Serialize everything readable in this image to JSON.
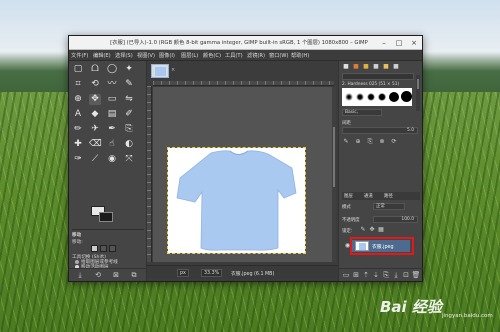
{
  "window": {
    "title": "[衣服] (已导入)-1.0 (RGB 颜色 8-bit gamma integer, GIMP built-in sRGB, 1 个图层) 1080x800 – GIMP",
    "controls": {
      "minimize": "–",
      "maximize": "□",
      "close": "×"
    }
  },
  "menubar": [
    "文件(F)",
    "编辑(E)",
    "选择(S)",
    "视图(V)",
    "图像(I)",
    "图层(L)",
    "颜色(C)",
    "工具(T)",
    "滤镜(R)",
    "窗口(W)",
    "帮助(H)"
  ],
  "toolbox": {
    "tools": [
      {
        "name": "rect-select-tool-icon",
        "glyph": "▢"
      },
      {
        "name": "lasso-tool-icon",
        "glyph": "ᗝ"
      },
      {
        "name": "ellipse-select-tool-icon",
        "glyph": "◯"
      },
      {
        "name": "fuzzy-select-tool-icon",
        "glyph": "✦"
      },
      {
        "name": "crop-tool-icon",
        "glyph": "⌗"
      },
      {
        "name": "transform-tool-icon",
        "glyph": "⟲"
      },
      {
        "name": "warp-tool-icon",
        "glyph": "〰"
      },
      {
        "name": "paths-tool-icon",
        "glyph": "✎"
      },
      {
        "name": "zoom-tool-icon",
        "glyph": "⊕"
      },
      {
        "name": "move-tool-icon",
        "glyph": "✥"
      },
      {
        "name": "align-tool-icon",
        "glyph": "▭"
      },
      {
        "name": "flip-tool-icon",
        "glyph": "⇋"
      },
      {
        "name": "text-tool-icon",
        "glyph": "A"
      },
      {
        "name": "bucket-fill-tool-icon",
        "glyph": "◆"
      },
      {
        "name": "gradient-tool-icon",
        "glyph": "▤"
      },
      {
        "name": "paintbrush-tool-icon",
        "glyph": "✐"
      },
      {
        "name": "pencil-tool-icon",
        "glyph": "✏"
      },
      {
        "name": "airbrush-tool-icon",
        "glyph": "✈"
      },
      {
        "name": "ink-tool-icon",
        "glyph": "✒"
      },
      {
        "name": "clone-tool-icon",
        "glyph": "⎘"
      },
      {
        "name": "heal-tool-icon",
        "glyph": "✚"
      },
      {
        "name": "eraser-tool-icon",
        "glyph": "⌫"
      },
      {
        "name": "smudge-tool-icon",
        "glyph": "☝"
      },
      {
        "name": "dodge-tool-icon",
        "glyph": "◐"
      },
      {
        "name": "color-picker-tool-icon",
        "glyph": "✑"
      },
      {
        "name": "measure-tool-icon",
        "glyph": "⟋"
      },
      {
        "name": "blur-tool-icon",
        "glyph": "◉"
      },
      {
        "name": "handle-transform-tool-icon",
        "glyph": "⤧"
      }
    ],
    "options_title": "移动",
    "options": {
      "mode_label": "移动:",
      "tool_toggle": "工具切换 (Shift)",
      "opt1": "拾取图层或参考线",
      "opt2": "移动活动图层"
    },
    "bottom_icons": [
      "⤓",
      "⟲",
      "⊠",
      "⧉"
    ]
  },
  "image": {
    "tab_close": "×",
    "status": {
      "unit": "px",
      "zoom": "33.3%",
      "info": "衣服.jpeg (6.1 MB)"
    }
  },
  "dock": {
    "tabs": [
      "■",
      "■",
      "■",
      "■",
      "■",
      "■"
    ],
    "tab_colors": [
      "#e0e0e0",
      "#e07b39",
      "#e0b040",
      "#d0d0d0",
      "#e8c060",
      "#d0d0d0"
    ],
    "brush_name": "2. Hardness 025 (51 × 51)",
    "brush_preset": "Basic,",
    "spacing_label": "间距",
    "spacing_value": "5.0",
    "layers_tabs": [
      "图层",
      "通道",
      "路径"
    ],
    "mode_label": "模式",
    "mode_value": "正常",
    "opacity_label": "不透明度",
    "opacity_value": "100.0",
    "lock_label": "锁定:",
    "layer_name": "衣服.jpeg",
    "bottom_icons": [
      "▭",
      "⊞",
      "⇡",
      "⇣",
      "⎘",
      "⤓",
      "⊡",
      "🗑"
    ]
  },
  "watermark": {
    "text": "Bai 经验",
    "sub": "jingyan.baidu.com"
  }
}
